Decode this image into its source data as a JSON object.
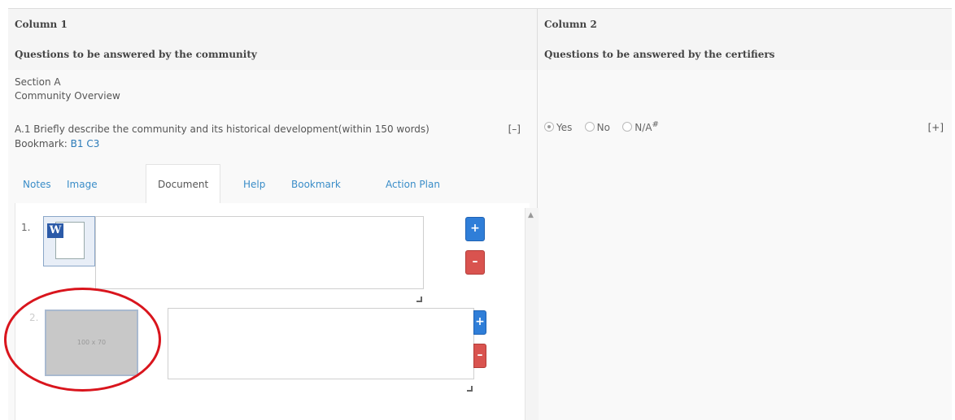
{
  "table": {
    "col1_header": "Column 1",
    "col2_header": "Column 2",
    "col1_sub": "Questions to be answered by the community",
    "col2_sub": "Questions to be answered by the certifiers",
    "section_label": "Section A",
    "section_title": "Community Overview"
  },
  "question": {
    "text": "A.1 Briefly describe the community and its historical development(within 150 words)",
    "collapse_toggle": "[–]",
    "bookmark_label": "Bookmark:",
    "bookmark_link": "B1 C3"
  },
  "tabs": [
    "Notes",
    "Image",
    "Document",
    "Help",
    "Bookmark",
    "Action Plan"
  ],
  "active_tab": "Document",
  "certifier": {
    "options": [
      "Yes",
      "No",
      "N/A"
    ],
    "na_marker": "#",
    "selected": "Yes",
    "expand_toggle": "[+]"
  },
  "documents": {
    "items": [
      {
        "number": "1.",
        "thumbnail": "word-document-icon",
        "value": ""
      },
      {
        "number": "2.",
        "thumbnail": "placeholder-image",
        "placeholder_text": "100 x 70",
        "value": ""
      }
    ],
    "add_label": "+",
    "remove_label": "–"
  },
  "colors": {
    "link": "#2a7ab8",
    "add_button": "#2f7ed8",
    "remove_button": "#d9534f",
    "highlight_circle": "#d9151d"
  }
}
